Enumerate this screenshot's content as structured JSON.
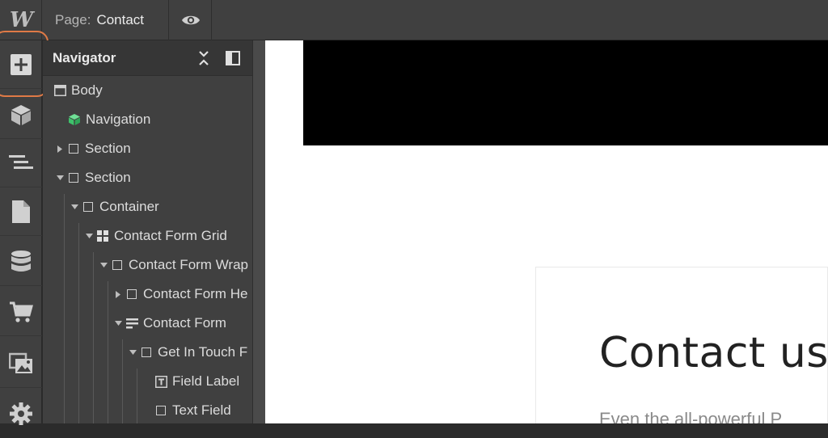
{
  "topbar": {
    "logo": "W",
    "page_label": "Page:",
    "page_name": "Contact",
    "preview_icon": "eye-icon"
  },
  "rail": {
    "items": [
      {
        "icon": "add-panel-icon",
        "active": true
      },
      {
        "icon": "symbols-cube-icon"
      },
      {
        "icon": "navigator-icon"
      },
      {
        "icon": "pages-icon"
      },
      {
        "icon": "cms-database-icon"
      },
      {
        "icon": "ecommerce-cart-icon"
      },
      {
        "icon": "assets-images-icon"
      },
      {
        "icon": "settings-gear-icon"
      }
    ],
    "highlight_color": "#e07a46"
  },
  "navigator": {
    "title": "Navigator",
    "collapse_icon": "collapse-arrows-icon",
    "dock_icon": "dock-panel-icon",
    "tree": [
      {
        "label": "Body",
        "icon": "body-window-icon",
        "caret": "none"
      },
      {
        "label": "Navigation",
        "icon": "symbol-cube-icon",
        "caret": "none"
      },
      {
        "label": "Section",
        "icon": "box-icon",
        "caret": "right"
      },
      {
        "label": "Section",
        "icon": "box-icon",
        "caret": "down"
      },
      {
        "label": "Container",
        "icon": "box-icon",
        "caret": "down"
      },
      {
        "label": "Contact Form Grid",
        "icon": "grid-icon",
        "caret": "down"
      },
      {
        "label": "Contact Form Wrap",
        "icon": "box-icon",
        "caret": "down"
      },
      {
        "label": "Contact Form He",
        "icon": "box-icon",
        "caret": "right"
      },
      {
        "label": "Contact Form",
        "icon": "form-icon",
        "caret": "down"
      },
      {
        "label": "Get In Touch F",
        "icon": "box-icon",
        "caret": "down"
      },
      {
        "label": "Field Label",
        "icon": "text-field-label-icon",
        "caret": "none"
      },
      {
        "label": "Text Field",
        "icon": "box-icon",
        "caret": "none"
      }
    ]
  },
  "canvas": {
    "heading": "Contact us",
    "subtext": "Even the all-powerful P"
  },
  "colors": {
    "ui_dark": "#404040",
    "symbol_green": "#3ec26b",
    "canvas_bg": "#ffffff",
    "hero_bg": "#000000"
  }
}
